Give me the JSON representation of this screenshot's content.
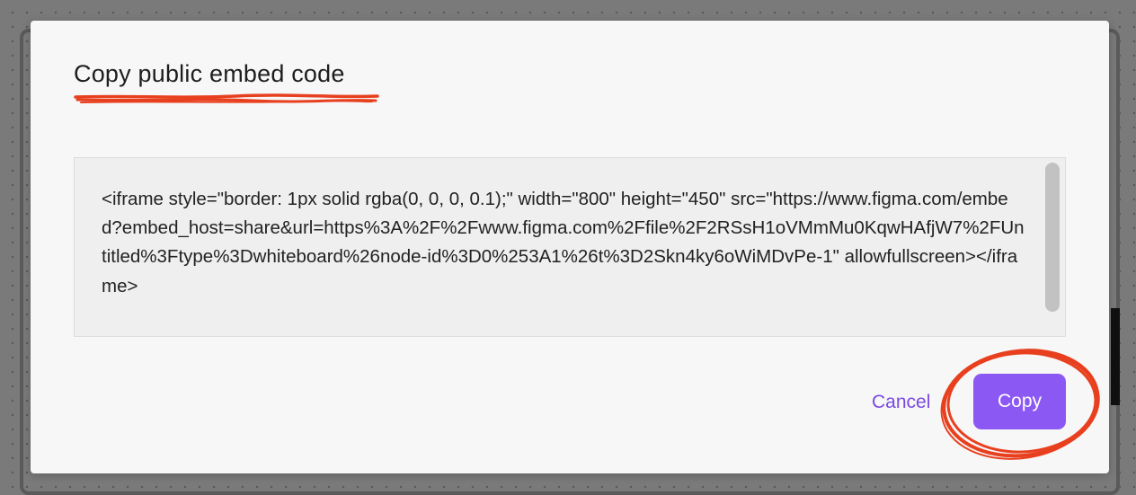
{
  "dialog": {
    "title": "Copy public embed code",
    "embed_code": "<iframe style=\"border: 1px solid rgba(0, 0, 0, 0.1);\" width=\"800\" height=\"450\" src=\"https://www.figma.com/embed?embed_host=share&url=https%3A%2F%2Fwww.figma.com%2Ffile%2F2RSsH1oVMmMu0KqwHAfjW7%2FUntitled%3Ftype%3Dwhiteboard%26node-id%3D0%253A1%26t%3D2Skn4ky6oWiMDvPe-1\" allowfullscreen></iframe>",
    "cancel_label": "Cancel",
    "copy_label": "Copy"
  },
  "colors": {
    "accent": "#8c58f4",
    "link": "#7b4ae2",
    "annotation": "#e8401f"
  }
}
